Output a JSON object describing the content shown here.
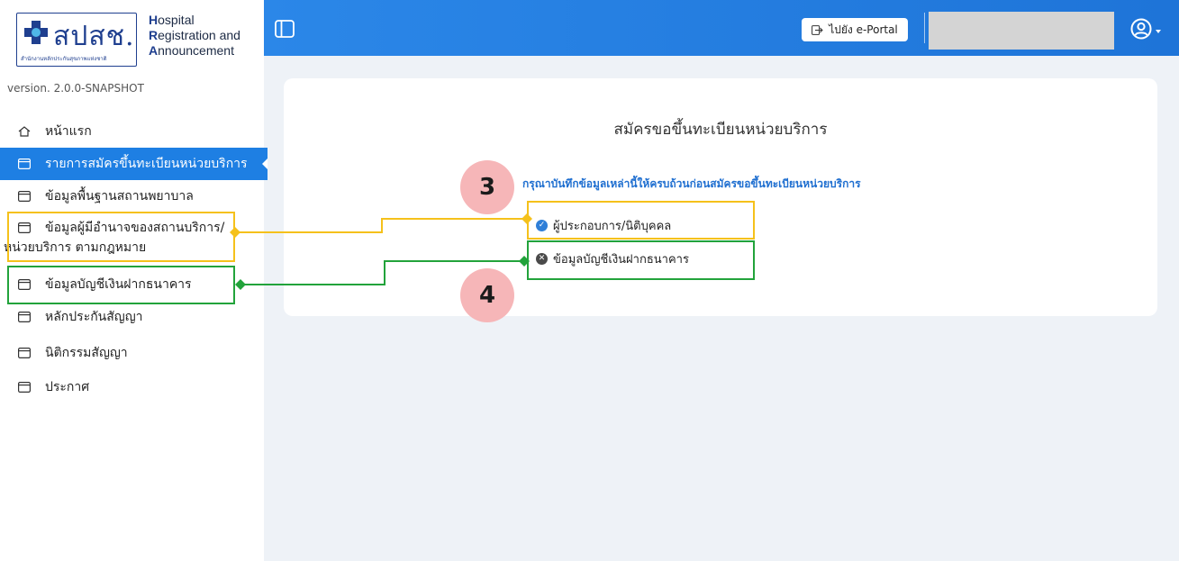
{
  "brand": {
    "logo_text": "สปสช.",
    "logo_sub": "สำนักงานหลักประกันสุขภาพแห่งชาติ",
    "line1_cap": "H",
    "line1_rest": "ospital",
    "line2_cap": "R",
    "line2_rest": "egistration and",
    "line3_cap": "A",
    "line3_rest": "nnouncement"
  },
  "version": "version. 2.0.0-SNAPSHOT",
  "sidebar": {
    "home": "หน้าแรก",
    "items": [
      {
        "label": "รายการสมัครขึ้นทะเบียนหน่วยบริการ"
      },
      {
        "label": "ข้อมูลพื้นฐานสถานพยาบาล"
      },
      {
        "label_line1": "ข้อมูลผู้มีอำนาจของสถานบริการ/",
        "label_line2": "หน่วยบริการ ตามกฎหมาย"
      },
      {
        "label": "ข้อมูลบัญชีเงินฝากธนาคาร"
      },
      {
        "label": "หลักประกันสัญญา"
      },
      {
        "label": "นิติกรรมสัญญา"
      },
      {
        "label": "ประกาศ"
      }
    ]
  },
  "topbar": {
    "portal_label": "ไปยัง e-Portal",
    "colors": {
      "accent": "#1e7fe3"
    }
  },
  "main": {
    "title": "สมัครขอขึ้นทะเบียนหน่วยบริการ",
    "instruction": "กรุณาบันทึกข้อมูลเหล่านี้ให้ครบถ้วนก่อนสมัครขอขึ้นทะเบียนหน่วยบริการ",
    "requirements": [
      {
        "label": "ผู้ประกอบการ/นิติบุคคล",
        "status": "complete",
        "icon": "check-circle-icon"
      },
      {
        "label": "ข้อมูลบัญชีเงินฝากธนาคาร",
        "status": "incomplete",
        "icon": "x-circle-icon"
      }
    ]
  },
  "annotations": {
    "badge_3": "3",
    "badge_4": "4",
    "colors": {
      "yellow": "#f5c11b",
      "green": "#22a33b",
      "badge": "#f6b6b8"
    }
  }
}
